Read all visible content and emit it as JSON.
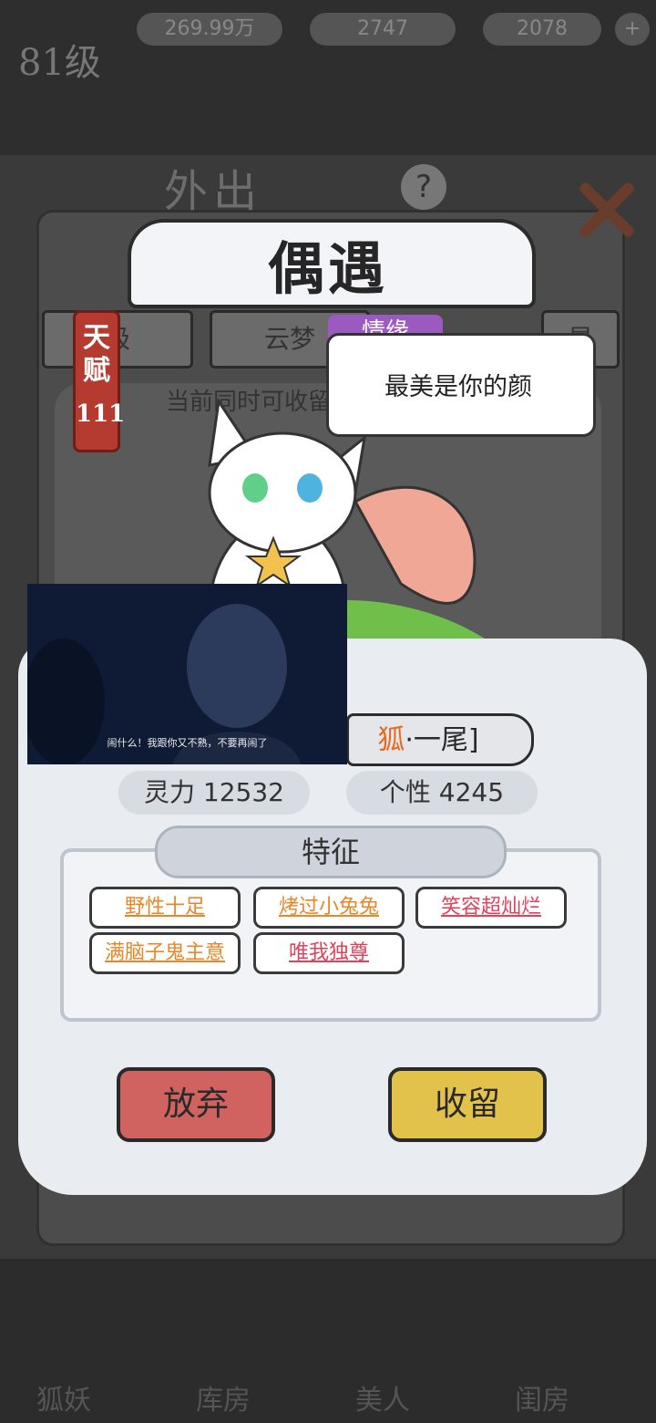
{
  "background": {
    "level": "81级",
    "currencies": [
      "269.99万",
      "2747",
      "2078"
    ],
    "outing_title": "外出",
    "nav_items": [
      "狐妖",
      "库房",
      "美人",
      "闺房"
    ]
  },
  "dialog": {
    "title": "偶遇",
    "tabs": [
      "极",
      "云梦",
      "情缘",
      "星"
    ],
    "selected_tab": "情缘",
    "talent_label": "天赋",
    "talent_value": "111",
    "current_text": "当前同时可收留",
    "speech": "最美是你的颜",
    "name_prefix": "狐",
    "name_rest": "·一尾]",
    "stats": {
      "spirit": "灵力 12532",
      "personality": "个性 4245"
    },
    "traits_title": "特征",
    "traits": [
      {
        "label": "野性十足",
        "color": "#e8862a"
      },
      {
        "label": "烤过小兔兔",
        "color": "#e8862a"
      },
      {
        "label": "笑容超灿烂",
        "color": "#e0425a"
      },
      {
        "label": "满脑子鬼主意",
        "color": "#e8862a"
      },
      {
        "label": "唯我独尊",
        "color": "#e0425a"
      }
    ],
    "buttons": {
      "abandon": "放弃",
      "keep": "收留"
    }
  },
  "video_overlay": {
    "subtitle": "闹什么！我跟你又不熟，不要再闹了"
  }
}
